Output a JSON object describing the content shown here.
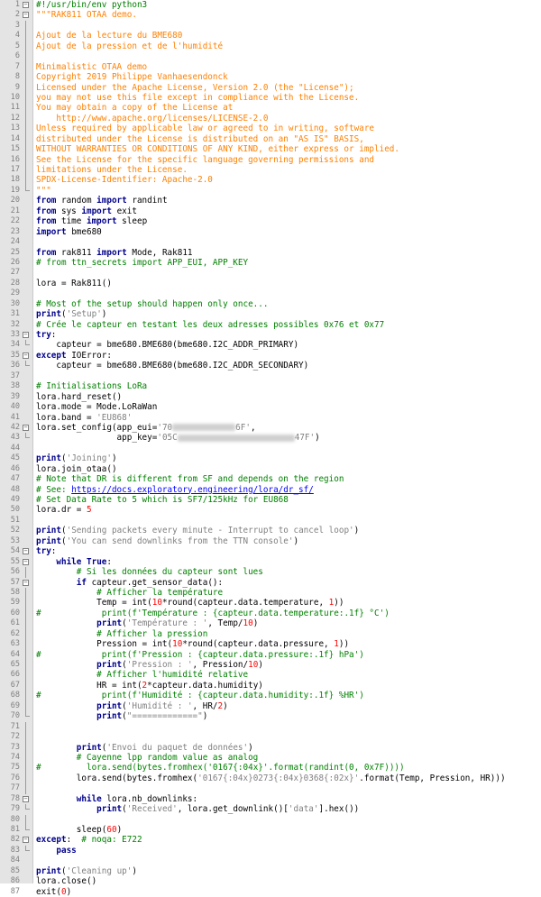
{
  "editor": {
    "lines": [
      {
        "n": "1",
        "text": "#!/usr/bin/env python3",
        "cls": "cm",
        "fold": "minus"
      },
      {
        "n": "2",
        "text": "\"\"\"RAK811 OTAA demo.",
        "cls": "doc",
        "fold": "minus"
      },
      {
        "n": "3",
        "text": "",
        "fold": "line"
      },
      {
        "n": "4",
        "text": "Ajout de la lecture du BME680",
        "cls": "doc",
        "fold": "line"
      },
      {
        "n": "5",
        "text": "Ajout de la pression et de l'humidité",
        "cls": "doc",
        "fold": "line"
      },
      {
        "n": "6",
        "text": "",
        "fold": "line"
      },
      {
        "n": "7",
        "text": "Minimalistic OTAA demo",
        "cls": "doc",
        "fold": "line"
      },
      {
        "n": "8",
        "text": "Copyright 2019 Philippe Vanhaesendonck",
        "cls": "doc",
        "fold": "line"
      },
      {
        "n": "9",
        "text": "Licensed under the Apache License, Version 2.0 (the \"License\");",
        "cls": "doc",
        "fold": "line"
      },
      {
        "n": "10",
        "text": "you may not use this file except in compliance with the License.",
        "cls": "doc",
        "fold": "line"
      },
      {
        "n": "11",
        "text": "You may obtain a copy of the License at",
        "cls": "doc",
        "fold": "line"
      },
      {
        "n": "12",
        "text": "    http://www.apache.org/licenses/LICENSE-2.0",
        "cls": "doc",
        "fold": "line"
      },
      {
        "n": "13",
        "text": "Unless required by applicable law or agreed to in writing, software",
        "cls": "doc",
        "fold": "line"
      },
      {
        "n": "14",
        "text": "distributed under the License is distributed on an \"AS IS\" BASIS,",
        "cls": "doc",
        "fold": "line"
      },
      {
        "n": "15",
        "text": "WITHOUT WARRANTIES OR CONDITIONS OF ANY KIND, either express or implied.",
        "cls": "doc",
        "fold": "line"
      },
      {
        "n": "16",
        "text": "See the License for the specific language governing permissions and",
        "cls": "doc",
        "fold": "line"
      },
      {
        "n": "17",
        "text": "limitations under the License.",
        "cls": "doc",
        "fold": "line"
      },
      {
        "n": "18",
        "text": "SPDX-License-Identifier: Apache-2.0",
        "cls": "doc",
        "fold": "line"
      },
      {
        "n": "19",
        "text": "\"\"\"",
        "cls": "doc",
        "fold": "end"
      },
      {
        "n": "20",
        "parts": [
          {
            "t": "from",
            "c": "kw"
          },
          {
            "t": " random "
          },
          {
            "t": "import",
            "c": "kw"
          },
          {
            "t": " randint"
          }
        ]
      },
      {
        "n": "21",
        "parts": [
          {
            "t": "from",
            "c": "kw"
          },
          {
            "t": " sys "
          },
          {
            "t": "import",
            "c": "kw"
          },
          {
            "t": " exit"
          }
        ]
      },
      {
        "n": "22",
        "parts": [
          {
            "t": "from",
            "c": "kw"
          },
          {
            "t": " time "
          },
          {
            "t": "import",
            "c": "kw"
          },
          {
            "t": " sleep"
          }
        ]
      },
      {
        "n": "23",
        "parts": [
          {
            "t": "import",
            "c": "kw"
          },
          {
            "t": " bme680"
          }
        ]
      },
      {
        "n": "24",
        "text": ""
      },
      {
        "n": "25",
        "parts": [
          {
            "t": "from",
            "c": "kw"
          },
          {
            "t": " rak811 "
          },
          {
            "t": "import",
            "c": "kw"
          },
          {
            "t": " Mode, Rak811"
          }
        ]
      },
      {
        "n": "26",
        "text": "# from ttn_secrets import APP_EUI, APP_KEY",
        "cls": "cm"
      },
      {
        "n": "27",
        "text": ""
      },
      {
        "n": "28",
        "text": "lora = Rak811()"
      },
      {
        "n": "29",
        "text": ""
      },
      {
        "n": "30",
        "text": "# Most of the setup should happen only once...",
        "cls": "cm"
      },
      {
        "n": "31",
        "parts": [
          {
            "t": "print",
            "c": "kw"
          },
          {
            "t": "("
          },
          {
            "t": "'Setup'",
            "c": "str"
          },
          {
            "t": ")"
          }
        ]
      },
      {
        "n": "32",
        "text": "# Crée le capteur en testant les deux adresses possibles 0x76 et 0x77",
        "cls": "cm"
      },
      {
        "n": "33",
        "parts": [
          {
            "t": "try",
            "c": "kw"
          },
          {
            "t": ":"
          }
        ],
        "fold": "minus"
      },
      {
        "n": "34",
        "text": "    capteur = bme680.BME680(bme680.I2C_ADDR_PRIMARY)",
        "fold": "end"
      },
      {
        "n": "35",
        "parts": [
          {
            "t": "except",
            "c": "kw"
          },
          {
            "t": " IOError:"
          }
        ],
        "fold": "minus"
      },
      {
        "n": "36",
        "text": "    capteur = bme680.BME680(bme680.I2C_ADDR_SECONDARY)",
        "fold": "end"
      },
      {
        "n": "37",
        "text": ""
      },
      {
        "n": "38",
        "text": "# Initialisations LoRa",
        "cls": "cm"
      },
      {
        "n": "39",
        "text": "lora.hard_reset()"
      },
      {
        "n": "40",
        "text": "lora.mode = Mode.LoRaWan"
      },
      {
        "n": "41",
        "parts": [
          {
            "t": "lora.band = "
          },
          {
            "t": "'EU868'",
            "c": "str"
          }
        ]
      },
      {
        "n": "42",
        "parts": [
          {
            "t": "lora.set_config(app_eui="
          },
          {
            "t": "'70",
            "c": "str"
          },
          {
            "blur": 70
          },
          {
            "t": "6F'",
            "c": "str"
          },
          {
            "t": ","
          }
        ],
        "fold": "minus"
      },
      {
        "n": "43",
        "parts": [
          {
            "t": "                app_key="
          },
          {
            "t": "'05C",
            "c": "str"
          },
          {
            "blur": 130
          },
          {
            "t": "47F'",
            "c": "str"
          },
          {
            "t": ")"
          }
        ],
        "fold": "end"
      },
      {
        "n": "44",
        "text": ""
      },
      {
        "n": "45",
        "parts": [
          {
            "t": "print",
            "c": "kw"
          },
          {
            "t": "("
          },
          {
            "t": "'Joining'",
            "c": "str"
          },
          {
            "t": ")"
          }
        ]
      },
      {
        "n": "46",
        "text": "lora.join_otaa()"
      },
      {
        "n": "47",
        "text": "# Note that DR is different from SF and depends on the region",
        "cls": "cm"
      },
      {
        "n": "48",
        "parts": [
          {
            "t": "# See: ",
            "c": "cm"
          },
          {
            "t": "https://docs.exploratory.engineering/lora/dr_sf/",
            "c": "url"
          }
        ]
      },
      {
        "n": "49",
        "text": "# Set Data Rate to 5 which is SF7/125kHz for EU868",
        "cls": "cm"
      },
      {
        "n": "50",
        "parts": [
          {
            "t": "lora.dr = "
          },
          {
            "t": "5",
            "c": "num"
          }
        ]
      },
      {
        "n": "51",
        "text": ""
      },
      {
        "n": "52",
        "parts": [
          {
            "t": "print",
            "c": "kw"
          },
          {
            "t": "("
          },
          {
            "t": "'Sending packets every minute - Interrupt to cancel loop'",
            "c": "str"
          },
          {
            "t": ")"
          }
        ]
      },
      {
        "n": "53",
        "parts": [
          {
            "t": "print",
            "c": "kw"
          },
          {
            "t": "("
          },
          {
            "t": "'You can send downlinks from the TTN console'",
            "c": "str"
          },
          {
            "t": ")"
          }
        ]
      },
      {
        "n": "54",
        "parts": [
          {
            "t": "try",
            "c": "kw"
          },
          {
            "t": ":"
          }
        ],
        "fold": "minus"
      },
      {
        "n": "55",
        "parts": [
          {
            "t": "    "
          },
          {
            "t": "while",
            "c": "kw"
          },
          {
            "t": " "
          },
          {
            "t": "True",
            "c": "kw"
          },
          {
            "t": ":"
          }
        ],
        "fold": "minus"
      },
      {
        "n": "56",
        "text": "        # Si les données du capteur sont lues",
        "cls": "cm",
        "fold": "line"
      },
      {
        "n": "57",
        "parts": [
          {
            "t": "        "
          },
          {
            "t": "if",
            "c": "kw"
          },
          {
            "t": " capteur.get_sensor_data():"
          }
        ],
        "fold": "minus"
      },
      {
        "n": "58",
        "text": "            # Afficher la température",
        "cls": "cm",
        "fold": "line"
      },
      {
        "n": "59",
        "parts": [
          {
            "t": "            Temp = int("
          },
          {
            "t": "10",
            "c": "num"
          },
          {
            "t": "*round(capteur.data.temperature, "
          },
          {
            "t": "1",
            "c": "num"
          },
          {
            "t": "))"
          }
        ],
        "fold": "line"
      },
      {
        "n": "60",
        "parts": [
          {
            "t": "#",
            "c": "cm"
          },
          {
            "t": "            "
          },
          {
            "t": "print(f'Température : {capteur.data.temperature:.1f} °C')",
            "c": "cm"
          }
        ],
        "fold": "line"
      },
      {
        "n": "61",
        "parts": [
          {
            "t": "            "
          },
          {
            "t": "print",
            "c": "kw"
          },
          {
            "t": "("
          },
          {
            "t": "'Température : '",
            "c": "str"
          },
          {
            "t": ", Temp/"
          },
          {
            "t": "10",
            "c": "num"
          },
          {
            "t": ")"
          }
        ],
        "fold": "line"
      },
      {
        "n": "62",
        "text": "            # Afficher la pression",
        "cls": "cm",
        "fold": "line"
      },
      {
        "n": "63",
        "parts": [
          {
            "t": "            Pression = int("
          },
          {
            "t": "10",
            "c": "num"
          },
          {
            "t": "*round(capteur.data.pressure, "
          },
          {
            "t": "1",
            "c": "num"
          },
          {
            "t": "))"
          }
        ],
        "fold": "line"
      },
      {
        "n": "64",
        "parts": [
          {
            "t": "#",
            "c": "cm"
          },
          {
            "t": "            "
          },
          {
            "t": "print(f'Pression : {capteur.data.pressure:.1f} hPa')",
            "c": "cm"
          }
        ],
        "fold": "line"
      },
      {
        "n": "65",
        "parts": [
          {
            "t": "            "
          },
          {
            "t": "print",
            "c": "kw"
          },
          {
            "t": "("
          },
          {
            "t": "'Pression : '",
            "c": "str"
          },
          {
            "t": ", Pression/"
          },
          {
            "t": "10",
            "c": "num"
          },
          {
            "t": ")"
          }
        ],
        "fold": "line"
      },
      {
        "n": "66",
        "text": "            # Afficher l'humidité relative",
        "cls": "cm",
        "fold": "line"
      },
      {
        "n": "67",
        "parts": [
          {
            "t": "            HR = int("
          },
          {
            "t": "2",
            "c": "num"
          },
          {
            "t": "*capteur.data.humidity)"
          }
        ],
        "fold": "line"
      },
      {
        "n": "68",
        "parts": [
          {
            "t": "#",
            "c": "cm"
          },
          {
            "t": "            "
          },
          {
            "t": "print(f'Humidité : {capteur.data.humidity:.1f} %HR')",
            "c": "cm"
          }
        ],
        "fold": "line"
      },
      {
        "n": "69",
        "parts": [
          {
            "t": "            "
          },
          {
            "t": "print",
            "c": "kw"
          },
          {
            "t": "("
          },
          {
            "t": "'Humidité : '",
            "c": "str"
          },
          {
            "t": ", HR/"
          },
          {
            "t": "2",
            "c": "num"
          },
          {
            "t": ")"
          }
        ],
        "fold": "line"
      },
      {
        "n": "70",
        "parts": [
          {
            "t": "            "
          },
          {
            "t": "print",
            "c": "kw"
          },
          {
            "t": "("
          },
          {
            "t": "\"=============\"",
            "c": "str"
          },
          {
            "t": ")"
          }
        ],
        "fold": "end"
      },
      {
        "n": "71",
        "text": "",
        "fold": "line"
      },
      {
        "n": "72",
        "text": "",
        "fold": "line"
      },
      {
        "n": "73",
        "parts": [
          {
            "t": "        "
          },
          {
            "t": "print",
            "c": "kw"
          },
          {
            "t": "("
          },
          {
            "t": "'Envoi du paquet de données'",
            "c": "str"
          },
          {
            "t": ")"
          }
        ],
        "fold": "line"
      },
      {
        "n": "74",
        "text": "        # Cayenne lpp random value as analog",
        "cls": "cm",
        "fold": "line"
      },
      {
        "n": "75",
        "parts": [
          {
            "t": "#",
            "c": "cm"
          },
          {
            "t": "         "
          },
          {
            "t": "lora.send(bytes.fromhex('0167{:04x}'.format(randint(0, 0x7F))))",
            "c": "cm"
          }
        ],
        "fold": "line"
      },
      {
        "n": "76",
        "parts": [
          {
            "t": "        lora.send(bytes.fromhex("
          },
          {
            "t": "'0167{:04x}0273{:04x}0368{:02x}'",
            "c": "str"
          },
          {
            "t": ".format(Temp, Pression, HR)))"
          }
        ],
        "fold": "line"
      },
      {
        "n": "77",
        "text": "",
        "fold": "line"
      },
      {
        "n": "78",
        "parts": [
          {
            "t": "        "
          },
          {
            "t": "while",
            "c": "kw"
          },
          {
            "t": " lora.nb_downlinks:"
          }
        ],
        "fold": "minus"
      },
      {
        "n": "79",
        "parts": [
          {
            "t": "            "
          },
          {
            "t": "print",
            "c": "kw"
          },
          {
            "t": "("
          },
          {
            "t": "'Received'",
            "c": "str"
          },
          {
            "t": ", lora.get_downlink()["
          },
          {
            "t": "'data'",
            "c": "str"
          },
          {
            "t": "].hex())"
          }
        ],
        "fold": "end"
      },
      {
        "n": "80",
        "text": "",
        "fold": "line"
      },
      {
        "n": "81",
        "parts": [
          {
            "t": "        sleep("
          },
          {
            "t": "60",
            "c": "num"
          },
          {
            "t": ")"
          }
        ],
        "fold": "end"
      },
      {
        "n": "82",
        "parts": [
          {
            "t": "except",
            "c": "kw"
          },
          {
            "t": ":  "
          },
          {
            "t": "# noqa: E722",
            "c": "cm"
          }
        ],
        "fold": "minus"
      },
      {
        "n": "83",
        "parts": [
          {
            "t": "    "
          },
          {
            "t": "pass",
            "c": "kw"
          }
        ],
        "fold": "end"
      },
      {
        "n": "84",
        "text": ""
      },
      {
        "n": "85",
        "parts": [
          {
            "t": "print",
            "c": "kw"
          },
          {
            "t": "("
          },
          {
            "t": "'Cleaning up'",
            "c": "str"
          },
          {
            "t": ")"
          }
        ]
      },
      {
        "n": "86",
        "text": "lora.close()"
      },
      {
        "n": "87",
        "parts": [
          {
            "t": "exit("
          },
          {
            "t": "0",
            "c": "num"
          },
          {
            "t": ")"
          }
        ]
      }
    ]
  }
}
